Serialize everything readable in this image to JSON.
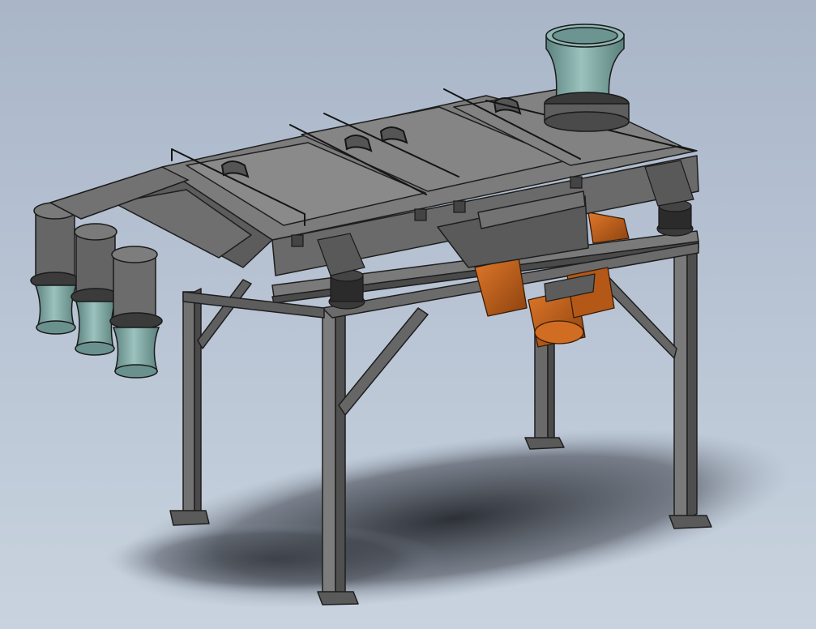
{
  "scene": {
    "subject": "vibratory-screen-separator",
    "colors": {
      "background_top": "#a9b6c8",
      "background_bottom": "#c9d3df",
      "steel_light": "#8a8a8a",
      "steel_mid": "#6e6e6e",
      "steel_dark": "#4b4b4b",
      "edge": "#1e1e1e",
      "rubber_teal": "#7fa7a3",
      "rubber_teal_dark": "#5a807c",
      "motor_orange": "#c8641c",
      "motor_orange_dark": "#8c420f",
      "shadow": "#2c2f36"
    },
    "parts": [
      "frame-stand",
      "screen-deck",
      "inlet-sleeve",
      "outlet-chutes",
      "vibration-motors",
      "rubber-mounts",
      "clamp-bars"
    ]
  }
}
